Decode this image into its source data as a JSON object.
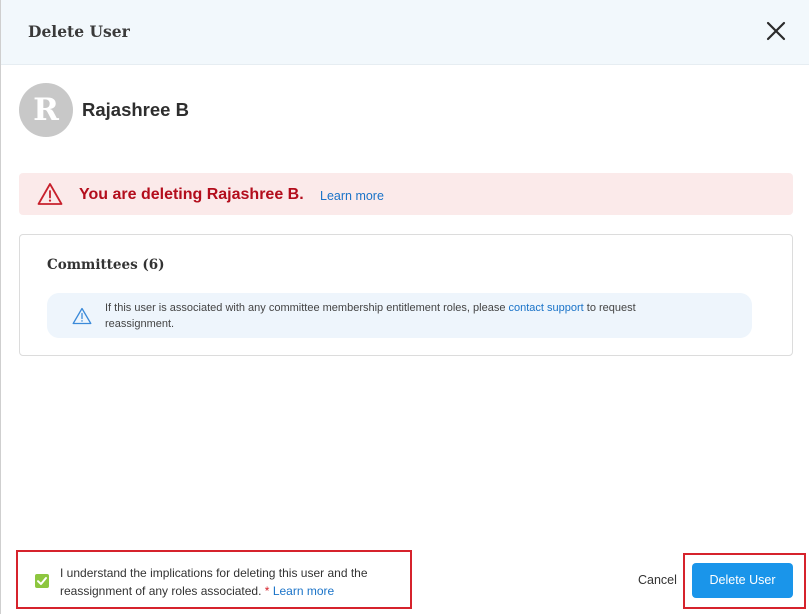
{
  "dialog": {
    "title": "Delete User",
    "close_icon": "close-icon"
  },
  "user": {
    "initial": "R",
    "name": "Rajashree B"
  },
  "warning": {
    "icon": "warning-triangle-icon",
    "message": "You are deleting Rajashree B.",
    "learn_more": "Learn more",
    "color": "#b30d1c",
    "background": "#fbeaea"
  },
  "committees": {
    "title": "Committees (6)",
    "info": {
      "icon": "info-triangle-icon",
      "text_before": "If this user is associated with any committee membership entitlement roles, please ",
      "link": "contact support",
      "text_after": " to request reassignment."
    }
  },
  "acknowledgement": {
    "checked": true,
    "text": "I understand the implications for deleting this user and the reassignment of any roles associated.",
    "required_mark": "*",
    "learn_more": "Learn more"
  },
  "footer": {
    "cancel_label": "Cancel",
    "delete_label": "Delete User",
    "primary_color": "#1a95ea"
  }
}
